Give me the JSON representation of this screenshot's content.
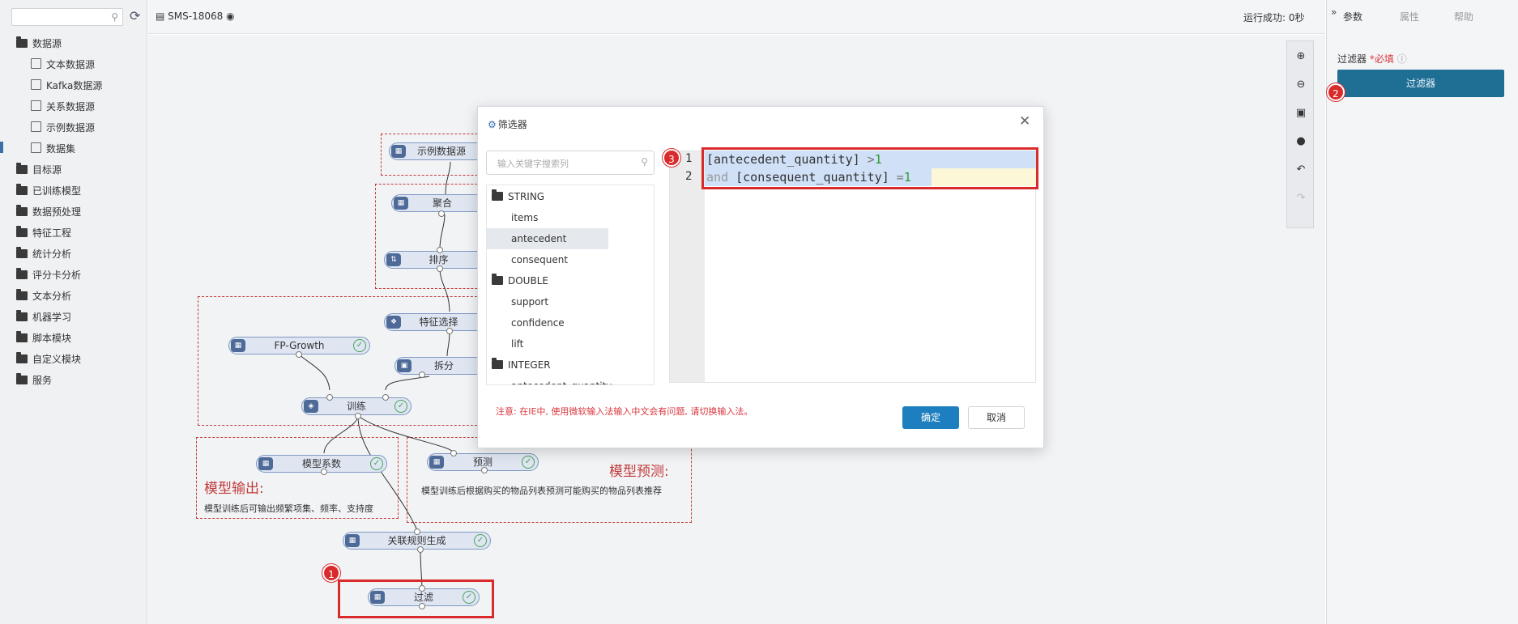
{
  "sidebar": {
    "search_placeholder": "",
    "items": [
      {
        "label": "数据源",
        "type": "folder"
      },
      {
        "label": "文本数据源",
        "type": "sub"
      },
      {
        "label": "Kafka数据源",
        "type": "sub"
      },
      {
        "label": "关系数据源",
        "type": "sub"
      },
      {
        "label": "示例数据源",
        "type": "sub"
      },
      {
        "label": "数据集",
        "type": "sub"
      },
      {
        "label": "目标源",
        "type": "folder"
      },
      {
        "label": "已训练模型",
        "type": "folder"
      },
      {
        "label": "数据预处理",
        "type": "folder"
      },
      {
        "label": "特征工程",
        "type": "folder"
      },
      {
        "label": "统计分析",
        "type": "folder"
      },
      {
        "label": "评分卡分析",
        "type": "folder"
      },
      {
        "label": "文本分析",
        "type": "folder"
      },
      {
        "label": "机器学习",
        "type": "folder"
      },
      {
        "label": "脚本模块",
        "type": "folder"
      },
      {
        "label": "自定义模块",
        "type": "folder"
      },
      {
        "label": "服务",
        "type": "folder"
      }
    ]
  },
  "topbar": {
    "title": "SMS-18068",
    "run_status": "运行成功: 0秒"
  },
  "canvas": {
    "nodes": {
      "sample_data": "示例数据源",
      "aggregate": "聚合",
      "sort": "排序",
      "feature_select": "特征选择",
      "fp_growth": "FP-Growth",
      "split": "拆分",
      "train": "训练",
      "model_coef": "模型系数",
      "predict": "预测",
      "assoc_rules": "关联规则生成",
      "filter": "过滤"
    },
    "groups": {
      "model_output_title": "模型输出:",
      "model_output_desc": "模型训练后可输出频繁项集、频率、支持度",
      "model_predict_title": "模型预测:",
      "model_predict_desc": "模型训练后根据购买的物品列表预测可能购买的物品列表推荐"
    },
    "badges": {
      "one": "1",
      "two": "2",
      "three": "3"
    }
  },
  "right_panel": {
    "tabs": [
      "参数",
      "属性",
      "帮助"
    ],
    "filter_label": "过滤器",
    "required": "*必填",
    "filter_button": "过滤器"
  },
  "modal": {
    "title": "筛选器",
    "search_placeholder": "输入关键字搜索列",
    "field_groups": [
      {
        "type": "STRING",
        "fields": [
          "items",
          "antecedent",
          "consequent"
        ]
      },
      {
        "type": "DOUBLE",
        "fields": [
          "support",
          "confidence",
          "lift"
        ]
      },
      {
        "type": "INTEGER",
        "fields": [
          "antecedent_quantity"
        ]
      }
    ],
    "selected_field": "antecedent",
    "code": {
      "line1_num": "1",
      "line1_field": "[antecedent_quantity]",
      "line1_op": " >",
      "line1_val": "1",
      "line2_num": "2",
      "line2_kw": "and",
      "line2_field": " [consequent_quantity]",
      "line2_op": " =",
      "line2_val": "1"
    },
    "notice": "注意: 在IE中, 使用微软输入法输入中文会有问题, 请切换输入法。",
    "ok": "确定",
    "cancel": "取消"
  },
  "colors": {
    "accent": "#1f6f95",
    "highlight": "#d92b2b",
    "ok": "#48a35a"
  }
}
